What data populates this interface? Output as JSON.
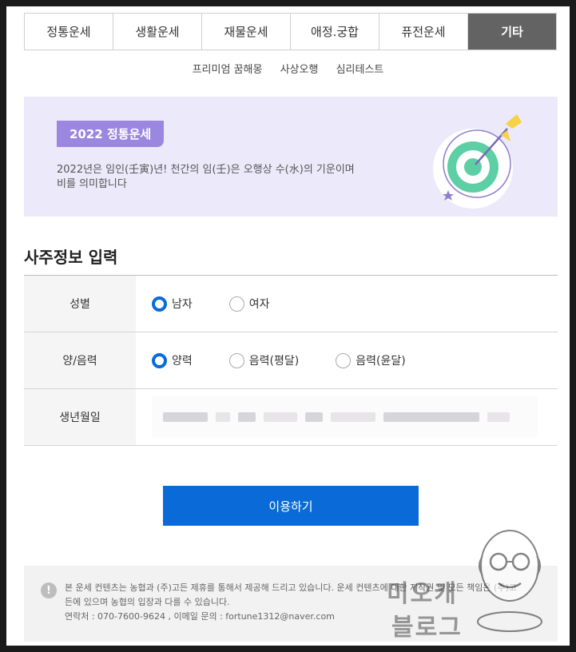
{
  "tabs": [
    {
      "label": "정통운세",
      "active": false
    },
    {
      "label": "생활운세",
      "active": false
    },
    {
      "label": "재물운세",
      "active": false
    },
    {
      "label": "애정.궁합",
      "active": false
    },
    {
      "label": "퓨전운세",
      "active": false
    },
    {
      "label": "기타",
      "active": true
    }
  ],
  "subnav": [
    "프리미엄 꿈해몽",
    "사상오행",
    "심리테스트"
  ],
  "banner": {
    "badge": "2022 정통운세",
    "desc_line1": "2022년은 임인(壬寅)년! 천간의 임(壬)은 오행상 수(水)의 기운이며",
    "desc_line2": "비를 의미합니다"
  },
  "section_title": "사주정보 입력",
  "form": {
    "gender": {
      "label": "성별",
      "options": [
        "남자",
        "여자"
      ],
      "selected": "남자"
    },
    "calendar": {
      "label": "양/음력",
      "options": [
        "양력",
        "음력(평달)",
        "음력(윤달)"
      ],
      "selected": "양력"
    },
    "birth": {
      "label": "생년월일"
    }
  },
  "submit_label": "이용하기",
  "notice": {
    "icon": "!",
    "line1": "본 운세 컨텐츠는 농협과 (주)고든 제휴를 통해서 제공해 드리고 있습니다. 운세 컨텐츠에 대한 저작권 및 모든 책임은 (주)고",
    "line2": "든에 있으며 농협의 입장과 다를 수 있습니다.",
    "line3": "연락처 : 070-7600-9624 , 이메일 문의 : fortune1312@naver.com"
  },
  "watermark": {
    "line1": "미오캐",
    "line2": "블로그"
  },
  "colors": {
    "accent": "#0a6bd8",
    "tab_active": "#636363",
    "banner_bg": "#ece9fb",
    "badge_bg": "#9b87e0",
    "target_green": "#5ccfa5"
  }
}
